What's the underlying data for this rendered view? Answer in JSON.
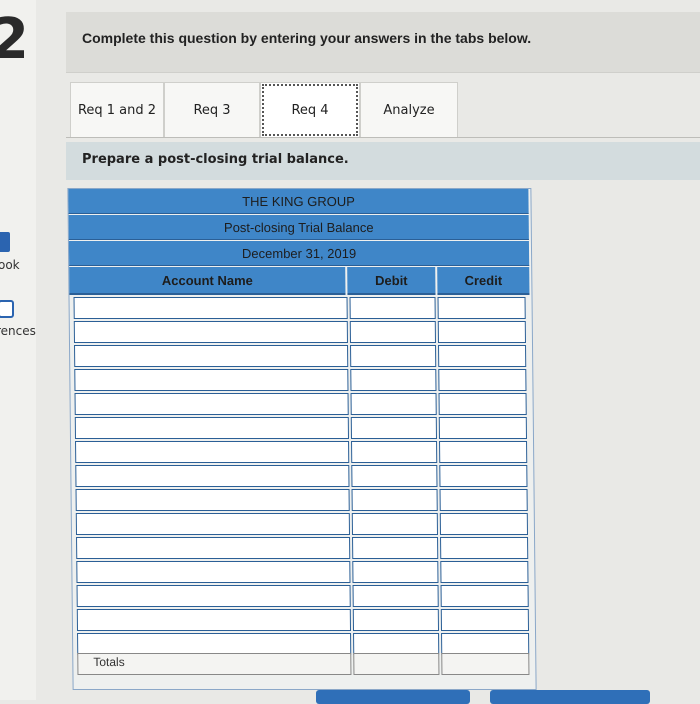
{
  "question": {
    "number": "2",
    "instruction": "Complete this question by entering your answers in the tabs below."
  },
  "sidebar": {
    "book_label": "ook",
    "references_label": "rences"
  },
  "tabs": [
    {
      "label": "Req 1 and 2",
      "active": false
    },
    {
      "label": "Req 3",
      "active": false
    },
    {
      "label": "Req 4",
      "active": true
    },
    {
      "label": "Analyze",
      "active": false
    }
  ],
  "prompt": "Prepare a post-closing trial balance.",
  "trial_balance": {
    "company": "THE KING GROUP",
    "title": "Post-closing Trial Balance",
    "date": "December 31, 2019",
    "columns": {
      "account": "Account Name",
      "debit": "Debit",
      "credit": "Credit"
    },
    "rows": [
      {
        "account": "",
        "debit": "",
        "credit": ""
      },
      {
        "account": "",
        "debit": "",
        "credit": ""
      },
      {
        "account": "",
        "debit": "",
        "credit": ""
      },
      {
        "account": "",
        "debit": "",
        "credit": ""
      },
      {
        "account": "",
        "debit": "",
        "credit": ""
      },
      {
        "account": "",
        "debit": "",
        "credit": ""
      },
      {
        "account": "",
        "debit": "",
        "credit": ""
      },
      {
        "account": "",
        "debit": "",
        "credit": ""
      },
      {
        "account": "",
        "debit": "",
        "credit": ""
      },
      {
        "account": "",
        "debit": "",
        "credit": ""
      },
      {
        "account": "",
        "debit": "",
        "credit": ""
      },
      {
        "account": "",
        "debit": "",
        "credit": ""
      },
      {
        "account": "",
        "debit": "",
        "credit": ""
      },
      {
        "account": "",
        "debit": "",
        "credit": ""
      },
      {
        "account": "",
        "debit": "",
        "credit": ""
      }
    ],
    "totals_label": "Totals"
  },
  "colors": {
    "header_blue": "#3f86c8",
    "border_blue": "#2b5f96"
  }
}
